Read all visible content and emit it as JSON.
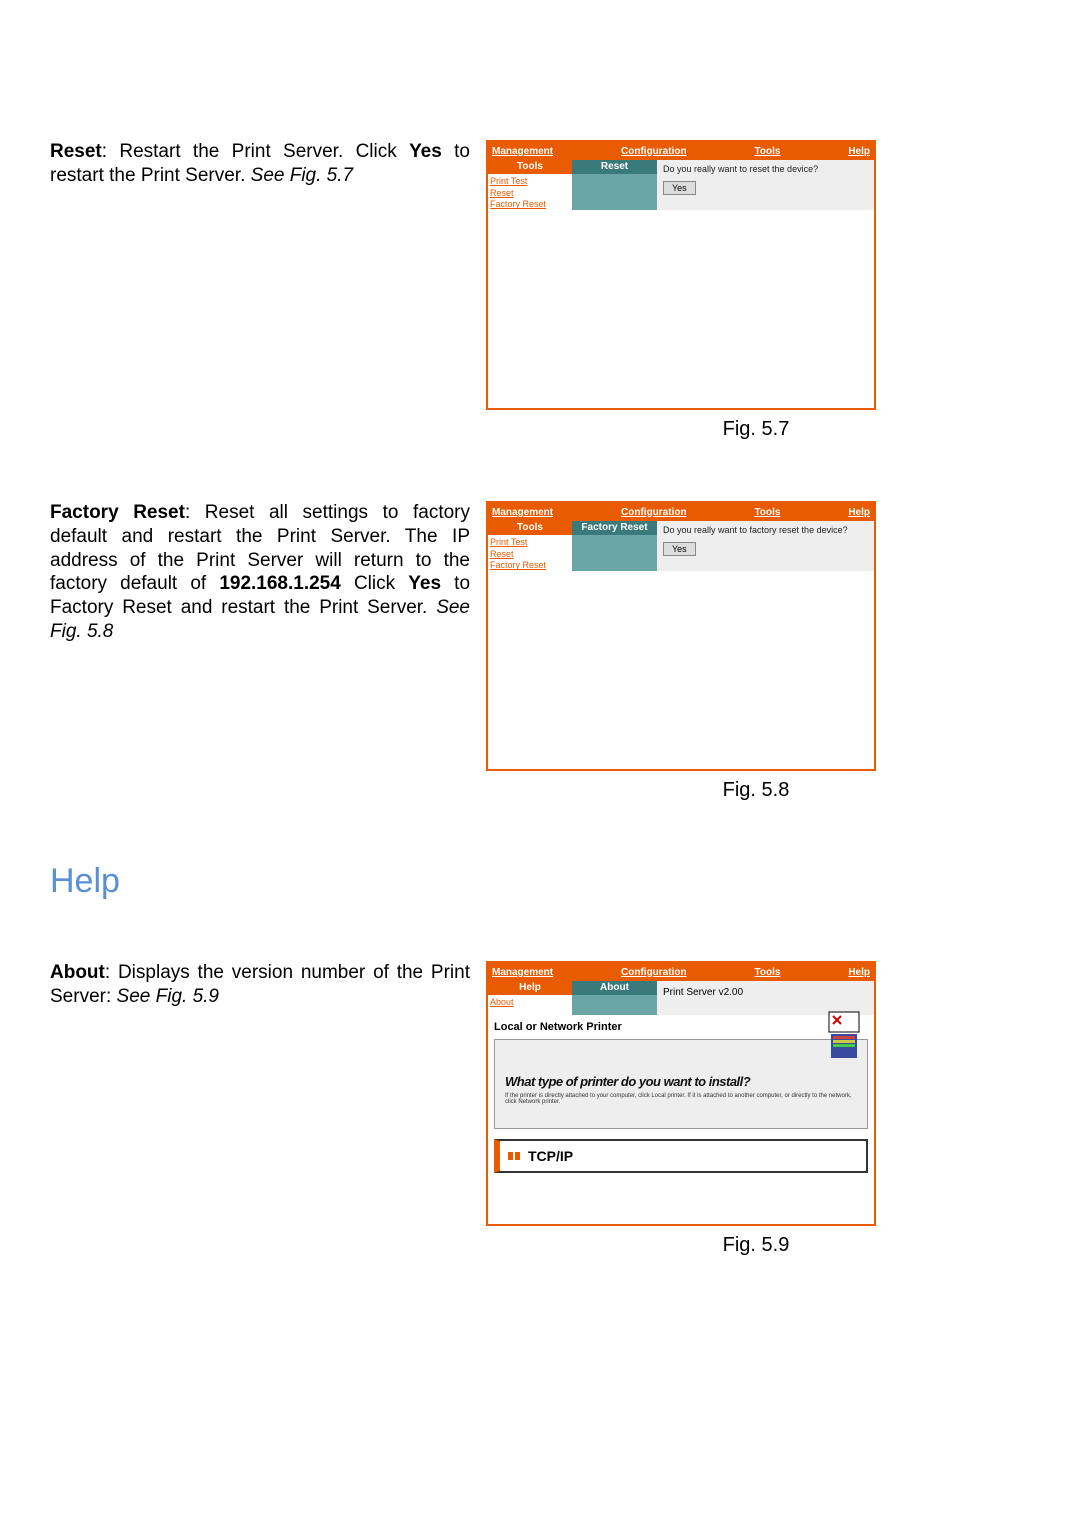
{
  "section_reset": {
    "bold": "Reset",
    "text1": ": Restart the Print Server. Click ",
    "bold2": "Yes",
    "text2": " to restart the Print Server. ",
    "ital": "See Fig. 5.7"
  },
  "section_factory": {
    "bold": "Factory Reset",
    "text1": ": Reset all settings to factory default and restart the Print Server. The IP address of the Print Server will return to the factory default of ",
    "bold2": "192.168.1.254",
    "text2": " Click ",
    "bold3": "Yes",
    "text3": " to Factory Reset and restart the Print Server. ",
    "ital": "See Fig. 5.8"
  },
  "heading_help": "Help",
  "section_about": {
    "bold": "About",
    "text1": ": Displays the version number of the Print Server: ",
    "ital": "See Fig. 5.9"
  },
  "nav": {
    "management": "Management",
    "configuration": "Configuration",
    "tools": "Tools",
    "help": "Help"
  },
  "sidebar_tools_hdr": "Tools",
  "sidebar_tools": {
    "print_test": "Print Test",
    "reset": "Reset",
    "factory_reset": "Factory Reset"
  },
  "sidebar_help_hdr": "Help",
  "sidebar_help": {
    "about": "About"
  },
  "panel_reset": {
    "hdr": "Reset",
    "question": "Do you really want to reset the device?",
    "yes": "Yes"
  },
  "panel_factory": {
    "hdr": "Factory Reset",
    "question": "Do you really want to factory reset the device?",
    "yes": "Yes"
  },
  "panel_about": {
    "hdr": "About",
    "version": "Print Server v2.00",
    "lower_hdr": "Local or Network Printer",
    "wizard_text": "What type of printer do you want to install?",
    "tcpip": "TCP/IP"
  },
  "captions": {
    "fig57": "Fig. 5.7",
    "fig58": "Fig. 5.8",
    "fig59": "Fig. 5.9"
  }
}
